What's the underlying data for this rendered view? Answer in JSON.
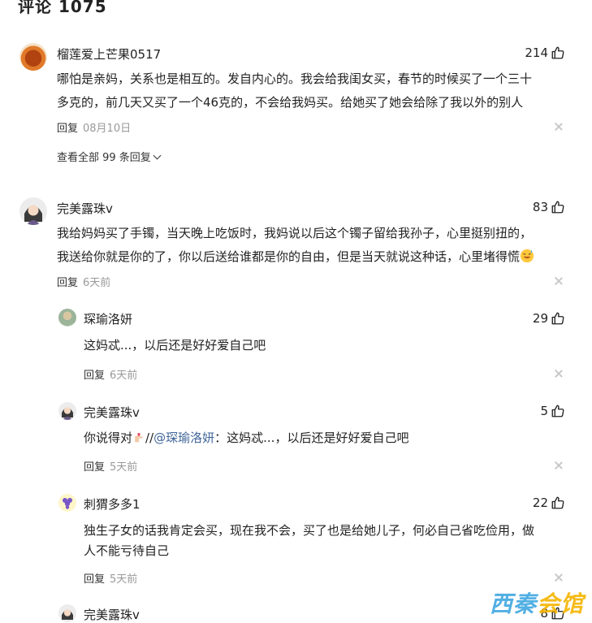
{
  "header": {
    "title": "评论 1075"
  },
  "comments": [
    {
      "user": "榴莲爱上芒果0517",
      "likes": "214",
      "text_lines": [
        "哪怕是亲妈，关系也是相互的。发自内心的。我会给我闺女买，春节的时候买了一个三十",
        "多克的，前几天又买了一个46克的，不会给我妈买。给她买了她会给除了我以外的别人"
      ],
      "reply_label": "回复",
      "date": "08月10日",
      "view_all": "查看全部 99 条回复"
    },
    {
      "user": "完美露珠v",
      "likes": "83",
      "text_lines": [
        "我给妈妈买了手镯，当天晚上吃饭时，我妈说以后这个镯子留给我孙子，心里挺别扭的，",
        "我送给你就是你的了，你以后送给谁都是你的自由，但是当天就说这种话，心里堵得慌"
      ],
      "reply_label": "回复",
      "date": "6天前"
    }
  ],
  "replies": [
    {
      "user": "琛瑜洛妍",
      "likes": "29",
      "text_lines": [
        "这妈忒...，以后还是好好爱自己吧"
      ],
      "reply_label": "回复",
      "date": "6天前"
    },
    {
      "user": "完美露珠v",
      "likes": "5",
      "text_prefix": "你说得对",
      "text_sep": "//",
      "mention": "@琛瑜洛妍",
      "text_suffix": "：这妈忒...，以后还是好好爱自己吧",
      "reply_label": "回复",
      "date": "5天前"
    },
    {
      "user": "刺猬多多1",
      "likes": "22",
      "text_lines": [
        "独生子女的话我肯定会买，现在我不会，买了也是给她儿子，何必自己省吃俭用，做",
        "人不能亏待自己"
      ],
      "reply_label": "回复",
      "date": "5天前"
    },
    {
      "user": "完美露珠v",
      "likes": "8"
    }
  ],
  "watermark": {
    "part1": "西秦",
    "part2": "会馆"
  },
  "icons": {
    "like": "thumbs-up-icon",
    "close": "close-icon",
    "chevron": "chevron-down-icon"
  }
}
